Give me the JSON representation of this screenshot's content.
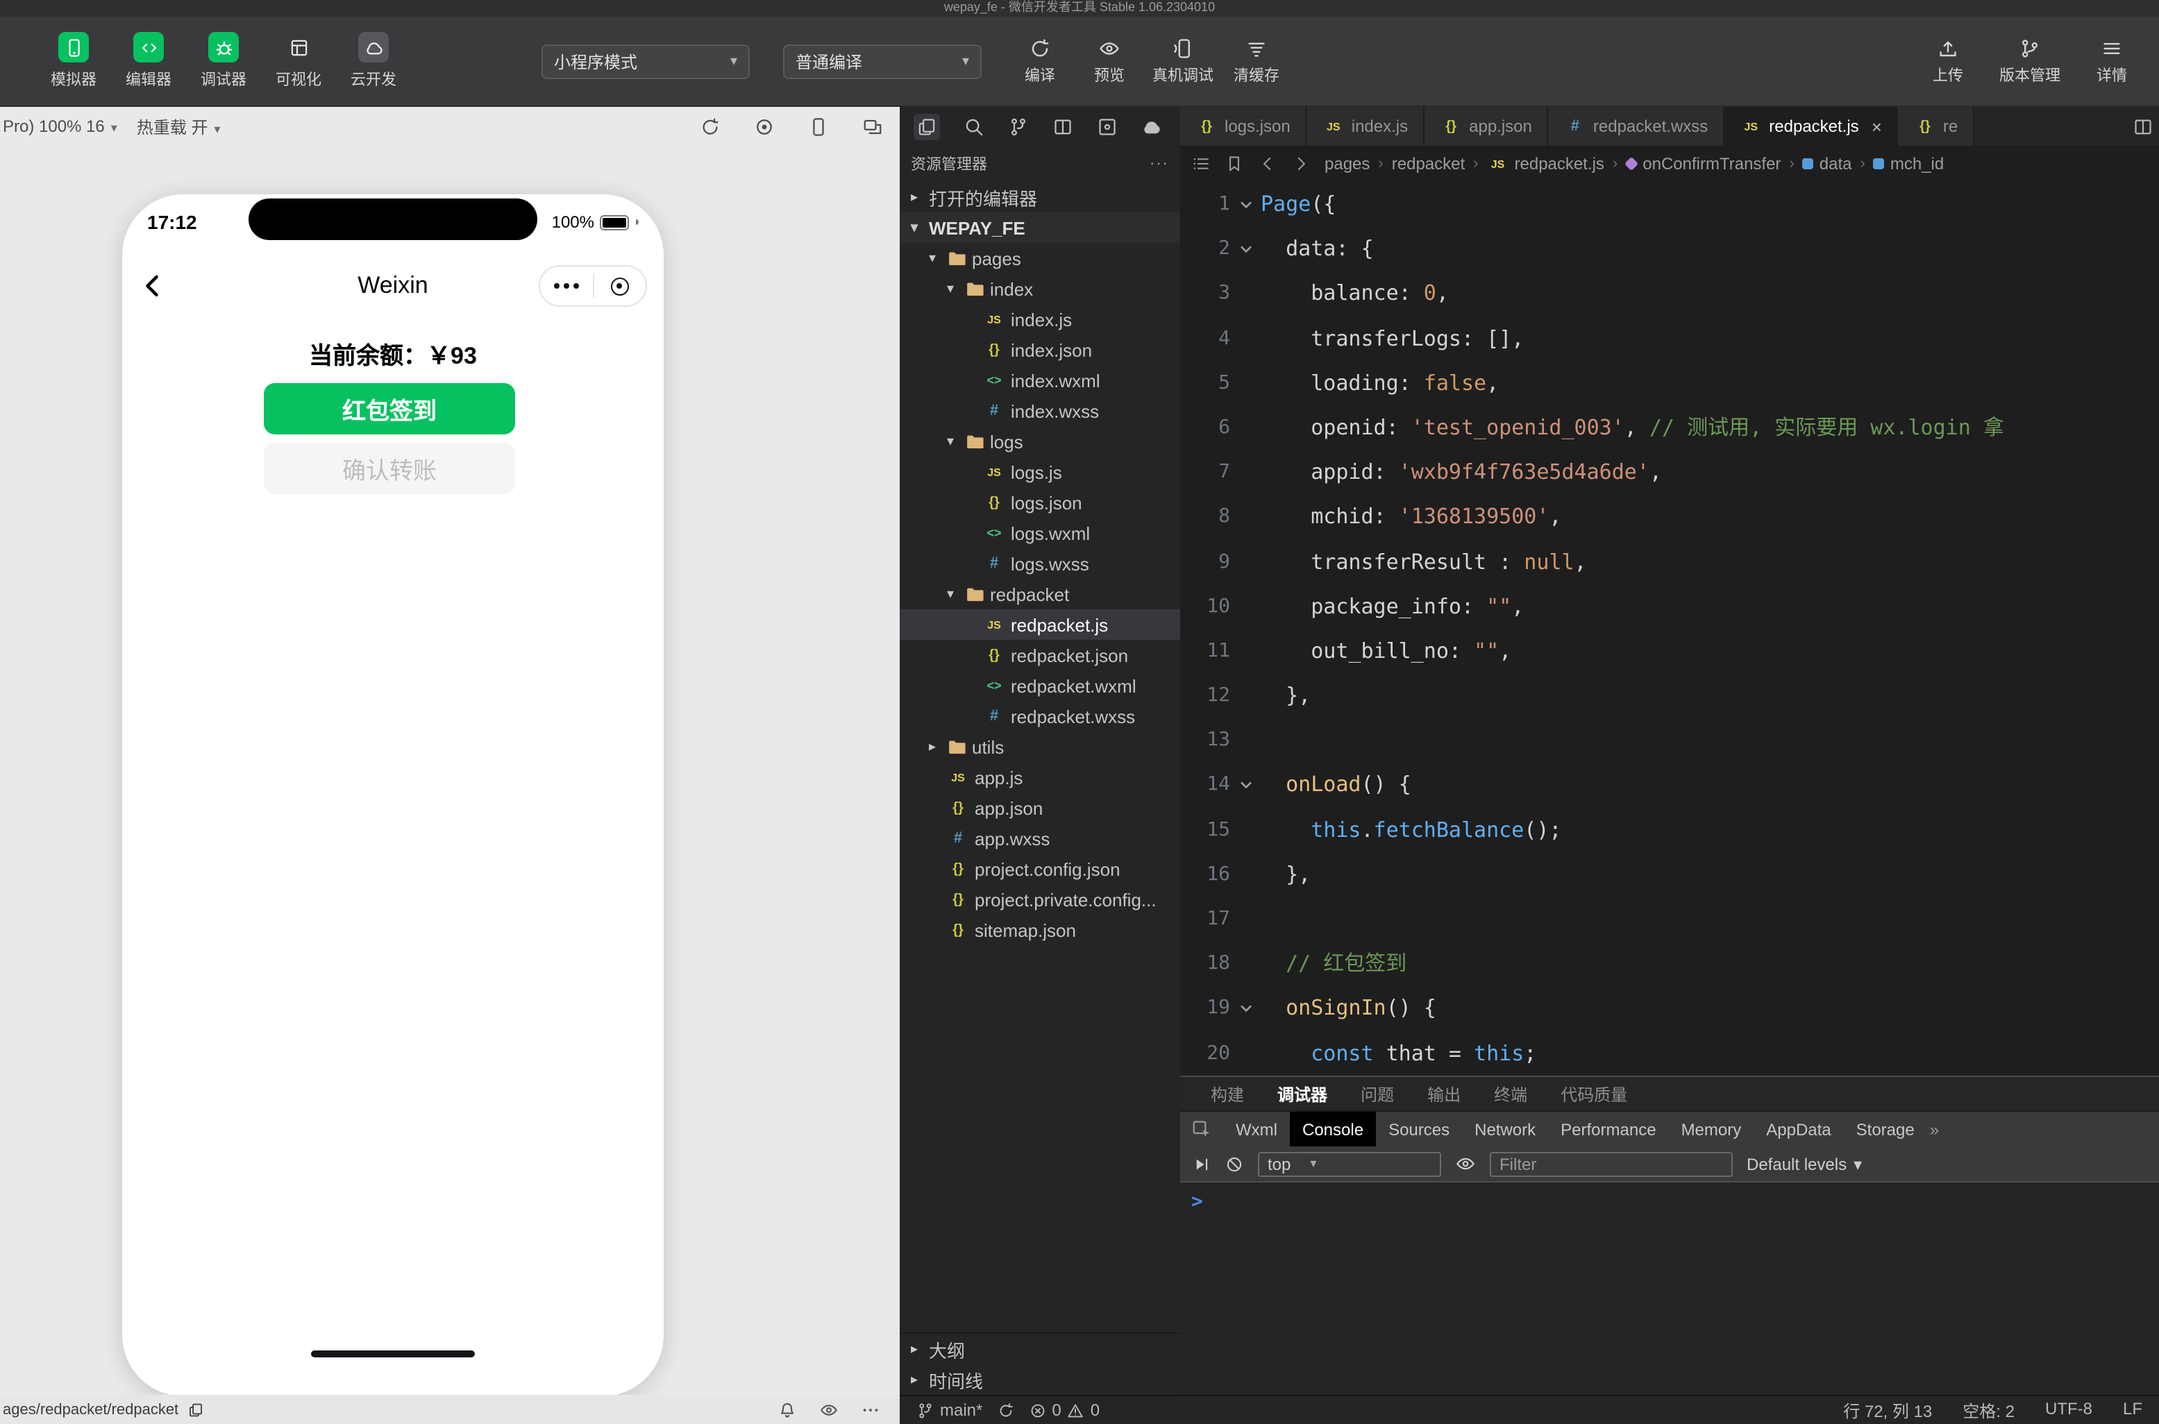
{
  "window": {
    "title": "wepay_fe - 微信开发者工具 Stable 1.06.2304010"
  },
  "colors": {
    "wechat_green": "#07c160",
    "console_prompt": "#4e88e8"
  },
  "toolbar": {
    "nav_buttons": [
      {
        "label": "模拟器",
        "icon": "simulator",
        "green": true
      },
      {
        "label": "编辑器",
        "icon": "editor",
        "green": true
      },
      {
        "label": "调试器",
        "icon": "inspector",
        "green": true
      },
      {
        "label": "可视化",
        "icon": "visual",
        "green": false
      },
      {
        "label": "云开发",
        "icon": "cloud-dev",
        "green": false
      }
    ],
    "mode_select": "小程序模式",
    "compile_select": "普通编译",
    "action_buttons": [
      {
        "label": "编译",
        "icon": "compile"
      },
      {
        "label": "预览",
        "icon": "preview"
      },
      {
        "label": "真机调试",
        "icon": "device-debug"
      },
      {
        "label": "清缓存",
        "icon": "clear-cache"
      }
    ],
    "right_buttons": [
      {
        "label": "上传",
        "icon": "upload"
      },
      {
        "label": "版本管理",
        "icon": "version"
      },
      {
        "label": "详情",
        "icon": "details"
      }
    ]
  },
  "simulator": {
    "device_zoom": "Pro) 100% 16",
    "hot_reload": "热重载 开",
    "phone": {
      "time": "17:12",
      "battery": "100%",
      "nav_title": "Weixin",
      "balance": "当前余额：￥93",
      "primary_button": "红包签到",
      "secondary_button": "确认转账"
    }
  },
  "explorer": {
    "title": "资源管理器",
    "open_editors": "打开的编辑器",
    "project": "WEPAY_FE",
    "outline": "大纲",
    "timeline": "时间线",
    "tree": [
      {
        "label": "pages",
        "type": "folder",
        "level": 1,
        "expanded": true
      },
      {
        "label": "index",
        "type": "folder",
        "level": 2,
        "expanded": true
      },
      {
        "label": "index.js",
        "type": "js",
        "level": 3
      },
      {
        "label": "index.json",
        "type": "json",
        "level": 3
      },
      {
        "label": "index.wxml",
        "type": "wxml",
        "level": 3
      },
      {
        "label": "index.wxss",
        "type": "wxss",
        "level": 3
      },
      {
        "label": "logs",
        "type": "folder",
        "level": 2,
        "expanded": true
      },
      {
        "label": "logs.js",
        "type": "js",
        "level": 3
      },
      {
        "label": "logs.json",
        "type": "json",
        "level": 3
      },
      {
        "label": "logs.wxml",
        "type": "wxml",
        "level": 3
      },
      {
        "label": "logs.wxss",
        "type": "wxss",
        "level": 3
      },
      {
        "label": "redpacket",
        "type": "folder",
        "level": 2,
        "expanded": true
      },
      {
        "label": "redpacket.js",
        "type": "js",
        "level": 3,
        "selected": true
      },
      {
        "label": "redpacket.json",
        "type": "json",
        "level": 3
      },
      {
        "label": "redpacket.wxml",
        "type": "wxml",
        "level": 3
      },
      {
        "label": "redpacket.wxss",
        "type": "wxss",
        "level": 3
      },
      {
        "label": "utils",
        "type": "folder",
        "level": 1,
        "expanded": false
      },
      {
        "label": "app.js",
        "type": "js",
        "level": 1
      },
      {
        "label": "app.json",
        "type": "json",
        "level": 1
      },
      {
        "label": "app.wxss",
        "type": "wxss",
        "level": 1
      },
      {
        "label": "project.config.json",
        "type": "json",
        "level": 1
      },
      {
        "label": "project.private.config...",
        "type": "json",
        "level": 1
      },
      {
        "label": "sitemap.json",
        "type": "json",
        "level": 1
      }
    ]
  },
  "editor": {
    "tabs": [
      {
        "label": "logs.json",
        "type": "json",
        "active": false
      },
      {
        "label": "index.js",
        "type": "js",
        "active": false
      },
      {
        "label": "app.json",
        "type": "json",
        "active": false
      },
      {
        "label": "redpacket.wxss",
        "type": "wxss",
        "active": false
      },
      {
        "label": "redpacket.js",
        "type": "js",
        "active": true
      },
      {
        "label": "re",
        "type": "json",
        "active": false,
        "partial": true
      }
    ],
    "breadcrumb": [
      {
        "label": "pages",
        "sym": ""
      },
      {
        "label": "redpacket",
        "sym": ""
      },
      {
        "label": "redpacket.js",
        "sym": "js"
      },
      {
        "label": "onConfirmTransfer",
        "sym": "method"
      },
      {
        "label": "data",
        "sym": "prop"
      },
      {
        "label": "mch_id",
        "sym": "prop"
      }
    ],
    "code_lines": [
      {
        "n": 1,
        "fold": true,
        "ind": 0,
        "t": [
          [
            "Page",
            "b"
          ],
          [
            "({",
            "p"
          ]
        ]
      },
      {
        "n": 2,
        "fold": true,
        "ind": 1,
        "t": [
          [
            "data",
            "p"
          ],
          [
            ": {",
            "p"
          ]
        ]
      },
      {
        "n": 3,
        "fold": false,
        "ind": 2,
        "t": [
          [
            "balance: ",
            "p"
          ],
          [
            "0",
            "o"
          ],
          [
            ",",
            "p"
          ]
        ]
      },
      {
        "n": 4,
        "fold": false,
        "ind": 2,
        "t": [
          [
            "transferLogs: [],",
            "p"
          ]
        ]
      },
      {
        "n": 5,
        "fold": false,
        "ind": 2,
        "t": [
          [
            "loading: ",
            "p"
          ],
          [
            "false",
            "o"
          ],
          [
            ",",
            "p"
          ]
        ]
      },
      {
        "n": 6,
        "fold": false,
        "ind": 2,
        "t": [
          [
            "openid: ",
            "p"
          ],
          [
            "'test_openid_003'",
            "s"
          ],
          [
            ", ",
            "p"
          ],
          [
            "// 测试用, 实际要用 wx.login 拿",
            "c"
          ]
        ]
      },
      {
        "n": 7,
        "fold": false,
        "ind": 2,
        "t": [
          [
            "appid: ",
            "p"
          ],
          [
            "'wxb9f4f763e5d4a6de'",
            "s"
          ],
          [
            ",",
            "p"
          ]
        ]
      },
      {
        "n": 8,
        "fold": false,
        "ind": 2,
        "t": [
          [
            "mchid: ",
            "p"
          ],
          [
            "'1368139500'",
            "s"
          ],
          [
            ",",
            "p"
          ]
        ]
      },
      {
        "n": 9,
        "fold": false,
        "ind": 2,
        "t": [
          [
            "transferResult : ",
            "p"
          ],
          [
            "null",
            "o"
          ],
          [
            ",",
            "p"
          ]
        ]
      },
      {
        "n": 10,
        "fold": false,
        "ind": 2,
        "t": [
          [
            "package_info: ",
            "p"
          ],
          [
            "\"\"",
            "s"
          ],
          [
            ",",
            "p"
          ]
        ]
      },
      {
        "n": 11,
        "fold": false,
        "ind": 2,
        "t": [
          [
            "out_bill_no: ",
            "p"
          ],
          [
            "\"\"",
            "s"
          ],
          [
            ",",
            "p"
          ]
        ]
      },
      {
        "n": 12,
        "fold": false,
        "ind": 1,
        "t": [
          [
            "},",
            "p"
          ]
        ]
      },
      {
        "n": 13,
        "fold": false,
        "ind": 0,
        "t": []
      },
      {
        "n": 14,
        "fold": true,
        "ind": 1,
        "t": [
          [
            "onLoad",
            "f"
          ],
          [
            "() {",
            "p"
          ]
        ]
      },
      {
        "n": 15,
        "fold": false,
        "ind": 2,
        "t": [
          [
            "this",
            "b"
          ],
          [
            ".",
            "p"
          ],
          [
            "fetchBalance",
            "b"
          ],
          [
            "();",
            "p"
          ]
        ]
      },
      {
        "n": 16,
        "fold": false,
        "ind": 1,
        "t": [
          [
            "},",
            "p"
          ]
        ]
      },
      {
        "n": 17,
        "fold": false,
        "ind": 0,
        "t": []
      },
      {
        "n": 18,
        "fold": false,
        "ind": 1,
        "t": [
          [
            "// 红包签到",
            "c"
          ]
        ]
      },
      {
        "n": 19,
        "fold": true,
        "ind": 1,
        "t": [
          [
            "onSignIn",
            "f"
          ],
          [
            "() {",
            "p"
          ]
        ]
      },
      {
        "n": 20,
        "fold": false,
        "ind": 2,
        "t": [
          [
            "const",
            "b"
          ],
          [
            " that = ",
            "p"
          ],
          [
            "this",
            "b"
          ],
          [
            ";",
            "p"
          ]
        ]
      }
    ]
  },
  "debugger": {
    "panel_tabs": [
      "构建",
      "调试器",
      "问题",
      "输出",
      "终端",
      "代码质量"
    ],
    "active_panel_tab": "调试器",
    "devtools_tabs": [
      "Wxml",
      "Console",
      "Sources",
      "Network",
      "Performance",
      "Memory",
      "AppData",
      "Storage"
    ],
    "active_devtools_tab": "Console",
    "overflow_chevron": "»",
    "console": {
      "context": "top",
      "filter_placeholder": "Filter",
      "levels": "Default levels",
      "prompt": ">"
    }
  },
  "statusbar": {
    "path": "ages/redpacket/redpacket",
    "branch": "main*",
    "errors": "0",
    "warnings": "0",
    "line_col": "行 72, 列 13",
    "spaces": "空格: 2",
    "encoding": "UTF-8",
    "eol": "LF"
  }
}
